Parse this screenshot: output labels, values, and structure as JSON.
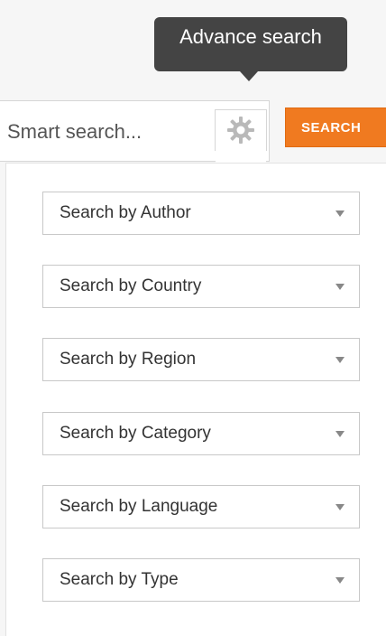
{
  "tooltip": {
    "text": "Advance search"
  },
  "search": {
    "placeholder": "Smart search...",
    "value": "",
    "button_label": "SEARCH",
    "settings_icon": "gear-icon"
  },
  "filters": [
    {
      "label": "Search by Author",
      "icon": "caret-down-icon"
    },
    {
      "label": "Search by Country",
      "icon": "caret-down-icon"
    },
    {
      "label": "Search by Region",
      "icon": "caret-down-icon"
    },
    {
      "label": "Search by Category",
      "icon": "caret-down-icon"
    },
    {
      "label": "Search by Language",
      "icon": "caret-down-icon"
    },
    {
      "label": "Search by Type",
      "icon": "caret-down-icon"
    }
  ],
  "colors": {
    "accent": "#f07a20",
    "tooltip_bg": "#444444"
  }
}
